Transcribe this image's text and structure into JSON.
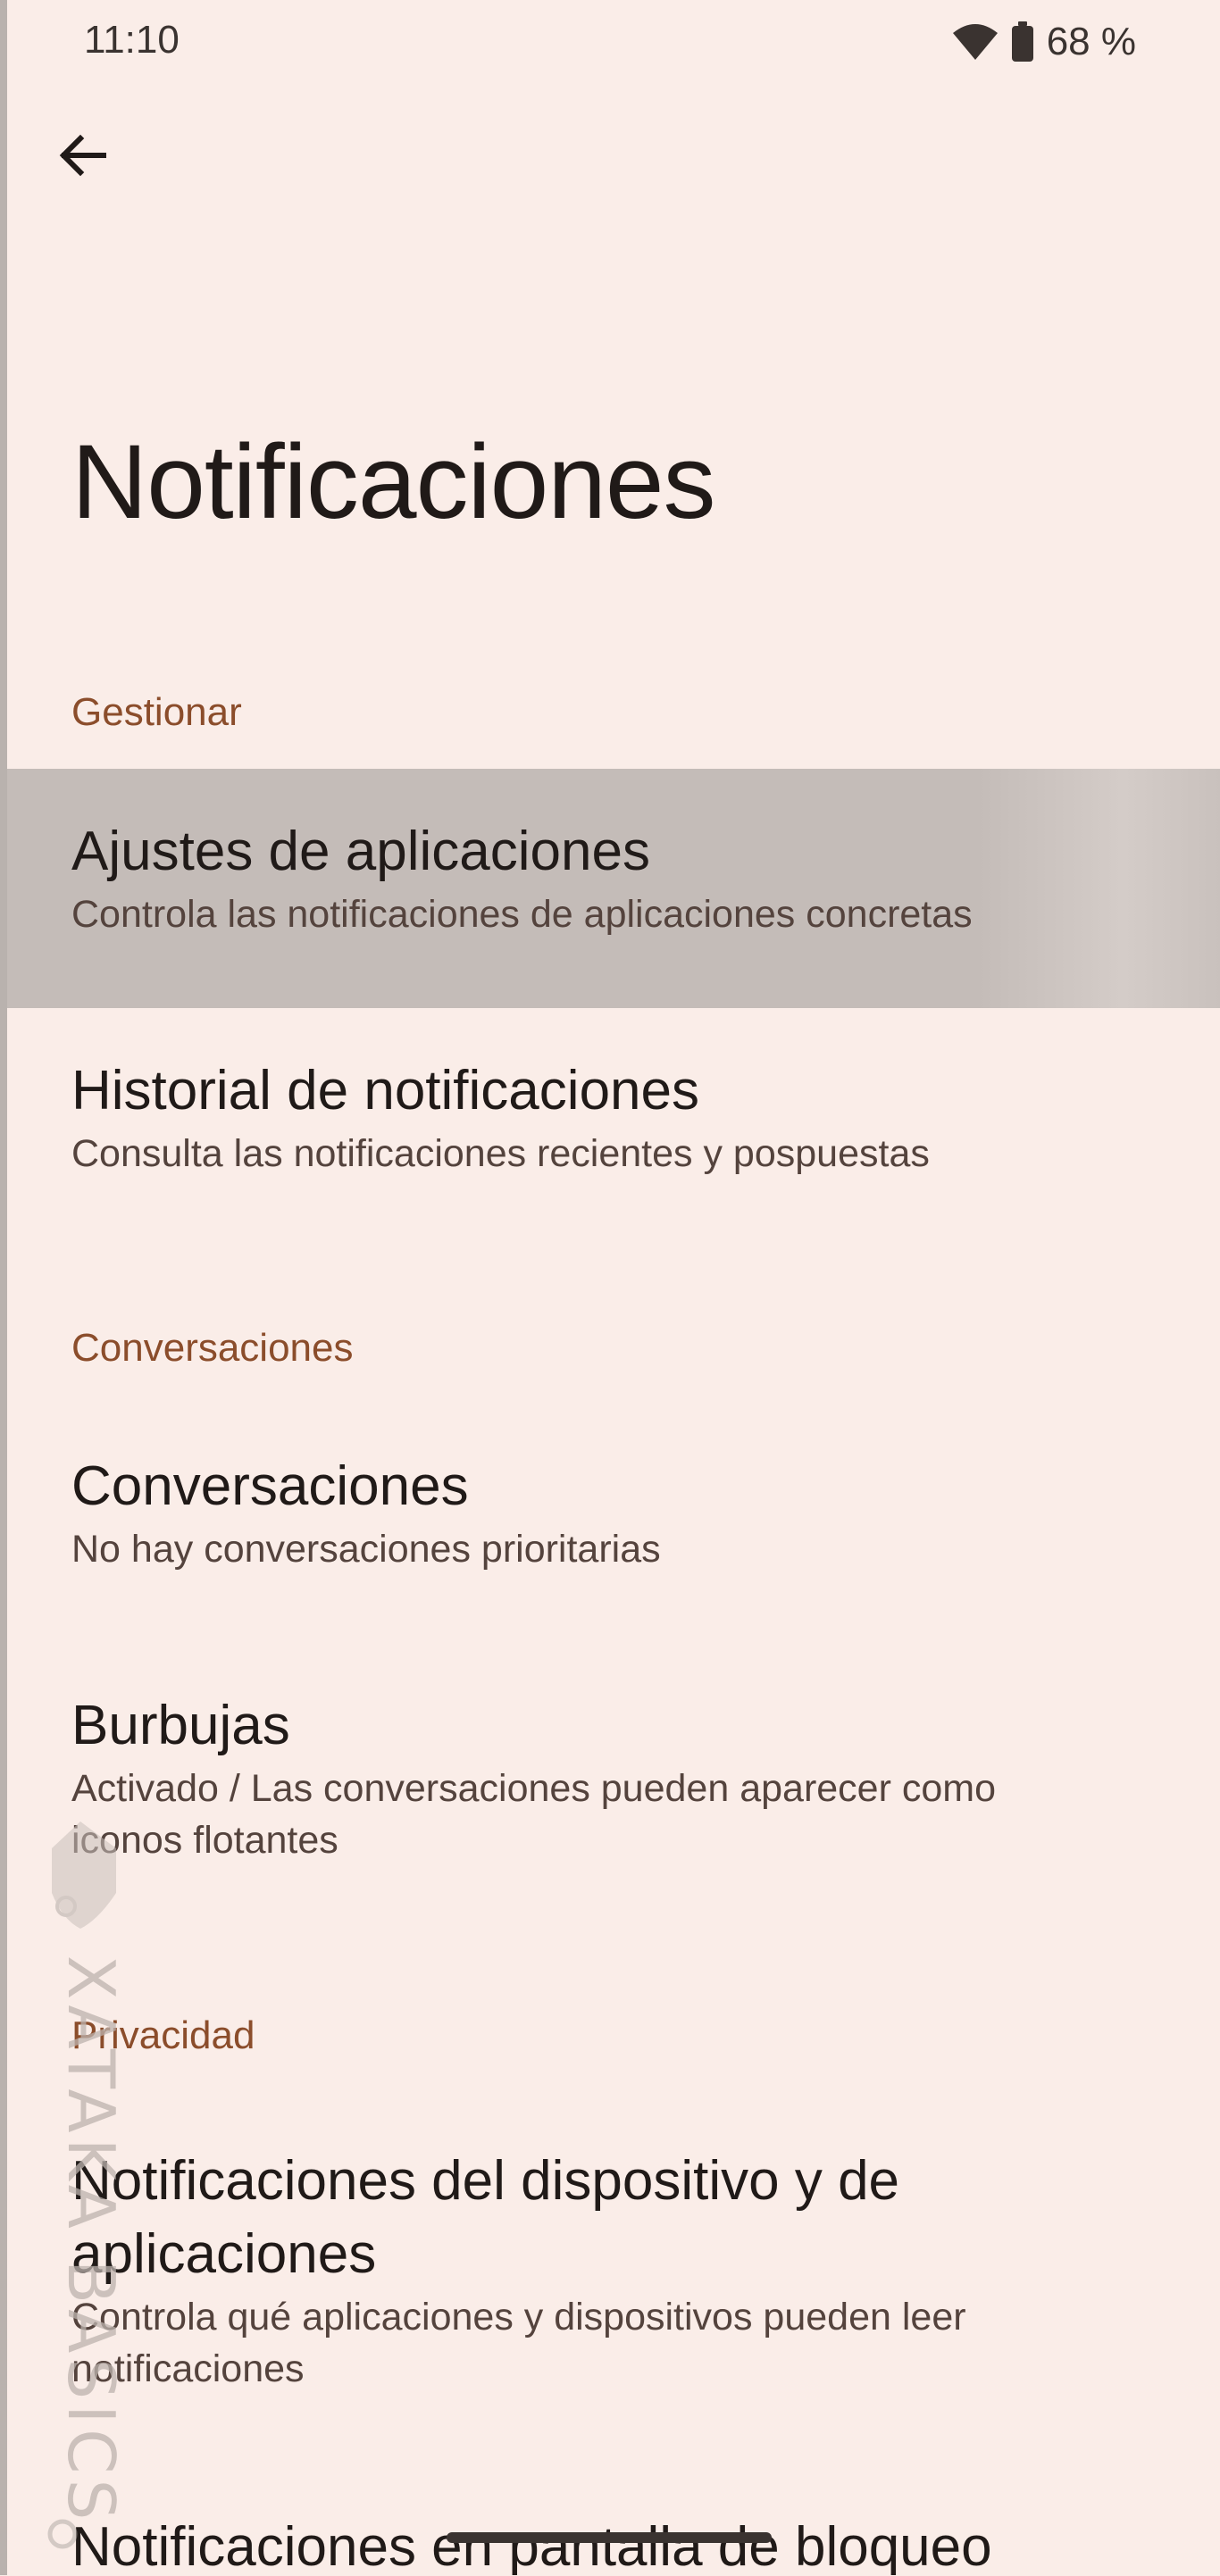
{
  "status_bar": {
    "time": "11:10",
    "wifi_icon": "wifi-icon",
    "battery_icon": "battery-icon",
    "battery_level": "68 %"
  },
  "toolbar": {
    "back_icon": "arrow-back-icon"
  },
  "page": {
    "title": "Notificaciones"
  },
  "sections": {
    "manage": {
      "header": "Gestionar",
      "items": [
        {
          "title": "Ajustes de aplicaciones",
          "summary": "Controla las notificaciones de aplicaciones concretas"
        },
        {
          "title": "Historial de notificaciones",
          "summary": "Consulta las notificaciones recientes y pospuestas"
        }
      ]
    },
    "conversations": {
      "header": "Conversaciones",
      "items": [
        {
          "title": "Conversaciones",
          "summary": "No hay conversaciones prioritarias"
        },
        {
          "title": "Burbujas",
          "summary_line1": "Activado / Las conversaciones pueden aparecer como",
          "summary_line2": "iconos flotantes"
        }
      ]
    },
    "privacy": {
      "header": "Privacidad",
      "items": [
        {
          "title_line1": "Notificaciones del dispositivo y de",
          "title_line2": "aplicaciones",
          "summary_line1": "Controla qué aplicaciones y dispositivos pueden leer",
          "summary_line2": "notificaciones"
        },
        {
          "title": "Notificaciones en pantalla de bloqueo"
        }
      ]
    }
  },
  "watermark": {
    "text": "XATAKA BASICS"
  },
  "colors": {
    "background": "#faede8",
    "accent": "#8b4d2b",
    "pressed": "#c4bcb8"
  }
}
